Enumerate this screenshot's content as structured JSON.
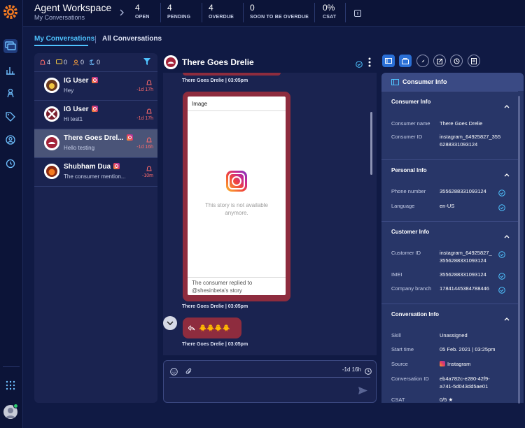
{
  "topbar": {
    "title": "Agent Workspace",
    "subtitle": "My Conversations",
    "stats": [
      {
        "value": "4",
        "label": "OPEN"
      },
      {
        "value": "4",
        "label": "PENDING"
      },
      {
        "value": "4",
        "label": "OVERDUE"
      },
      {
        "value": "0",
        "label": "SOON TO BE OVERDUE"
      },
      {
        "value": "0%",
        "label": "CSAT"
      }
    ]
  },
  "tabs": {
    "my": "My Conversations",
    "all": "All Conversations"
  },
  "filters": {
    "alerts": "4",
    "messages": "0",
    "users": "0",
    "sleeping": "0"
  },
  "conversations": [
    {
      "name": "IG User",
      "preview": "Hey",
      "time": "-1d 17h"
    },
    {
      "name": "IG User",
      "preview": "Hi test1",
      "time": "-1d 17h"
    },
    {
      "name": "There Goes Drel...",
      "preview": "Hello testing",
      "time": "-1d 16h"
    },
    {
      "name": "Shubham Dua",
      "preview": "The consumer mention...",
      "time": "-10m"
    }
  ],
  "chat": {
    "title": "There Goes Drelie",
    "meta_top": "There Goes Drelie  |  03:05pm",
    "card_header": "Image",
    "card_unavailable": "This story is not available anymore.",
    "card_reply": "The consumer replied to @shesinbeta's story",
    "meta_mid": "There Goes Drelie  |  03:05pm",
    "emoji_text": "🐥🐥🐥🐥",
    "meta_bottom": "There Goes Drelie  |  03:05pm",
    "composer_time": "-1d 16h"
  },
  "panel": {
    "title": "Consumer Info",
    "sections": {
      "consumer": {
        "title": "Consumer Info",
        "rows": [
          {
            "k": "Consumer name",
            "v": "There Goes Drelie"
          },
          {
            "k": "Consumer ID",
            "v1": "instagram_64925827_355",
            "v2": "6288331093124"
          }
        ]
      },
      "personal": {
        "title": "Personal Info",
        "rows": [
          {
            "k": "Phone number",
            "v": "3556288331093124"
          },
          {
            "k": "Language",
            "v": "en-US"
          }
        ]
      },
      "customer": {
        "title": "Customer Info",
        "rows": [
          {
            "k": "Customer ID",
            "v1": "instagram_64925827_",
            "v2": "3556288331093124"
          },
          {
            "k": "IMEI",
            "v": "3556288331093124"
          },
          {
            "k": "Company branch",
            "v": "17841445384788446"
          }
        ]
      },
      "conversation": {
        "title": "Conversation Info",
        "rows": [
          {
            "k": "Skill",
            "v": "Unassigned"
          },
          {
            "k": "Start time",
            "v": "05 Feb. 2021 | 03:25pm"
          },
          {
            "k": "Source",
            "v": "Instagram"
          },
          {
            "k": "Conversation ID",
            "v1": "eb4a782c-e280-42f9-",
            "v2": "a741-5d043dd5ae01"
          },
          {
            "k": "CSAT",
            "v": "0/5 ★"
          }
        ]
      }
    }
  },
  "colors": {
    "accent": "#4fc3ff",
    "bubble": "#8e2c3e",
    "alert": "#ff6b6b",
    "bg": "#101a44"
  }
}
